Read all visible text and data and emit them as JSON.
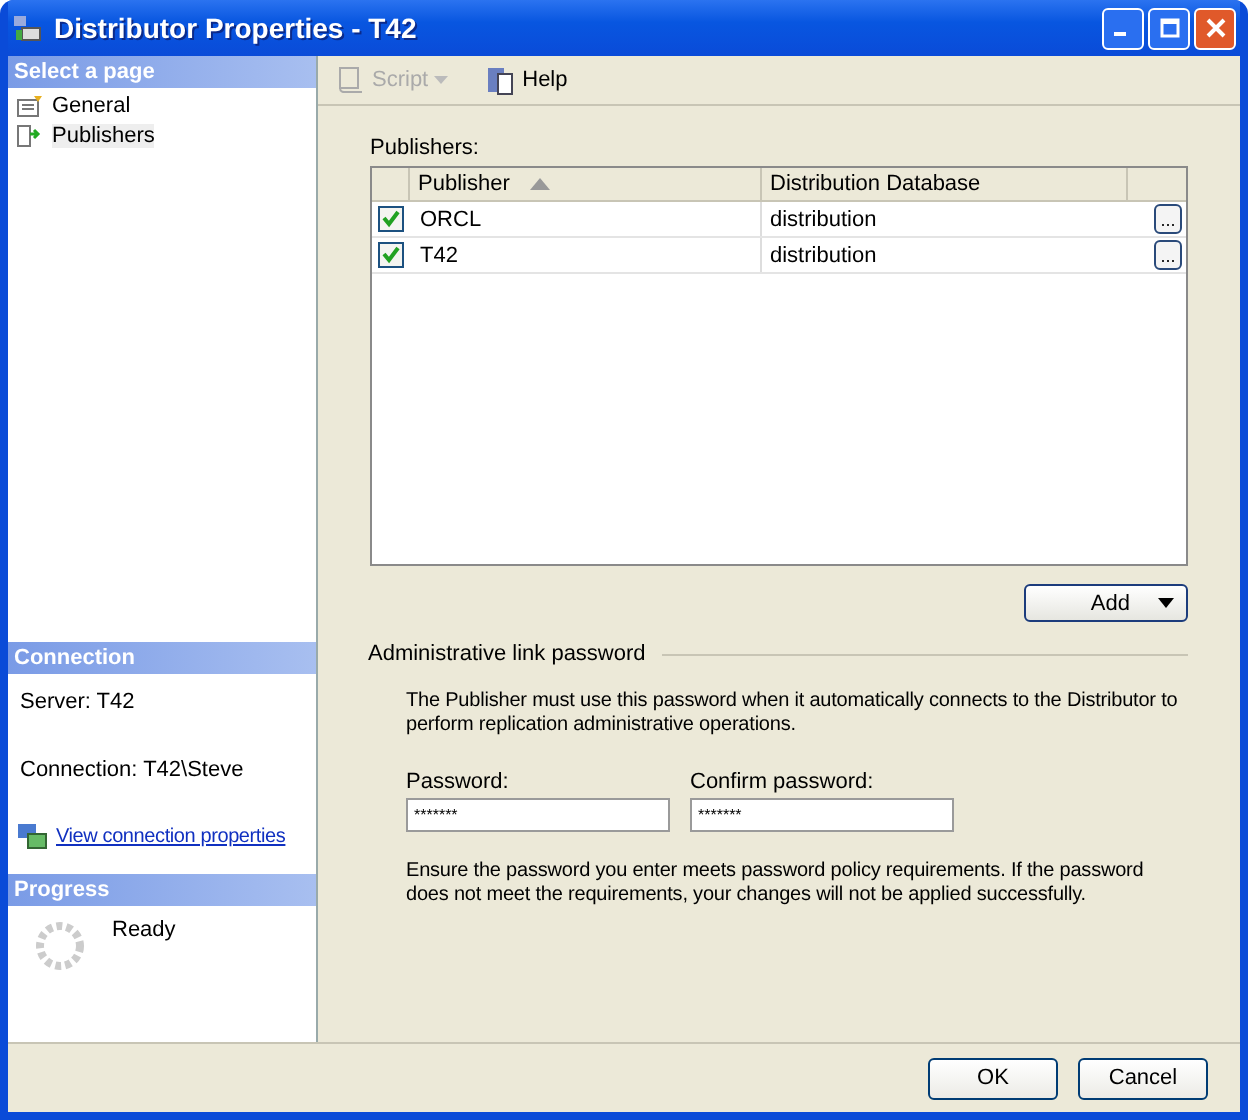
{
  "window": {
    "title": "Distributor Properties - T42"
  },
  "sidebar": {
    "header": "Select a page",
    "items": [
      {
        "label": "General",
        "selected": false,
        "kind": "general"
      },
      {
        "label": "Publishers",
        "selected": true,
        "kind": "publishers"
      }
    ]
  },
  "connection": {
    "header": "Connection",
    "server": "Server: T42",
    "connection": "Connection: T42\\Steve",
    "link": "View connection properties"
  },
  "progress": {
    "header": "Progress",
    "status": "Ready"
  },
  "toolbar": [
    {
      "label": "Script",
      "kind": "script",
      "disabled": true
    },
    {
      "label": "Help",
      "kind": "help",
      "disabled": false
    }
  ],
  "publishers": {
    "label": "Publishers:",
    "columns": [
      "Publisher",
      "Distribution Database"
    ],
    "rows": [
      {
        "checked": true,
        "publisher": "ORCL",
        "database": "distribution",
        "button": "..."
      },
      {
        "checked": true,
        "publisher": "T42",
        "database": "distribution",
        "button": "..."
      }
    ]
  },
  "add_button": "Add",
  "password_section": {
    "title": "Administrative link password",
    "description": "The Publisher must use this password when it automatically connects to the Distributor to perform replication administrative operations.",
    "fields": [
      {
        "label": "Password:",
        "value": "*******"
      },
      {
        "label": "Confirm password:",
        "value": "*******"
      }
    ],
    "note": "Ensure the password you enter meets password policy requirements. If the password does not meet the requirements, your changes will not be applied successfully."
  },
  "buttons": [
    "OK",
    "Cancel"
  ]
}
